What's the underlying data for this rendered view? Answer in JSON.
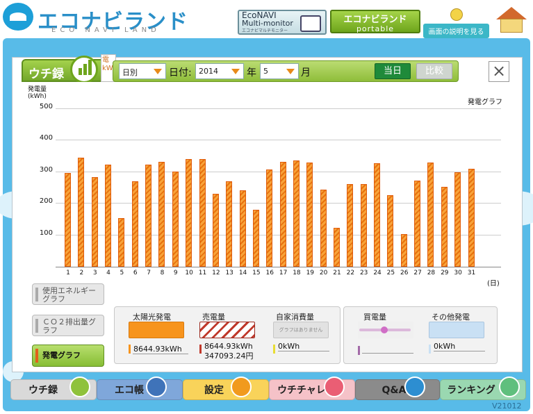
{
  "header": {
    "logo_text": "エコナビランド",
    "logo_sub": "ECO NAVI LAND",
    "econavi_line1": "EcoNAVI",
    "econavi_line2": "Multi-monitor",
    "econavi_line3": "エコナビマルチモニター",
    "portable_line1": "エコナビランド",
    "portable_line2": "portable",
    "help_label": "画面の説明を見る"
  },
  "panel": {
    "title": "ウチ録",
    "tab_kw": "電 kW",
    "period_select": "日別",
    "date_label": "日付:",
    "year_value": "2014",
    "year_label": "年",
    "month_value": "5",
    "month_label": "月",
    "today_button": "当日",
    "compare_button": "比較",
    "close_icon": "×"
  },
  "chart_data": {
    "type": "bar",
    "title": "発電グラフ",
    "ylabel": "発電量 (kWh)",
    "ylim": [
      0,
      500
    ],
    "yticks": [
      "100",
      "200",
      "300",
      "400",
      "500"
    ],
    "x_unit": "(日)",
    "categories": [
      "1",
      "2",
      "3",
      "4",
      "5",
      "6",
      "7",
      "8",
      "9",
      "10",
      "11",
      "12",
      "13",
      "14",
      "15",
      "16",
      "17",
      "18",
      "19",
      "20",
      "21",
      "22",
      "23",
      "24",
      "25",
      "26",
      "27",
      "28",
      "29",
      "30",
      "31"
    ],
    "values": [
      295,
      345,
      283,
      322,
      153,
      270,
      323,
      331,
      300,
      340,
      339,
      230,
      270,
      242,
      180,
      306,
      332,
      336,
      328,
      243,
      123,
      261,
      262,
      327,
      225,
      102,
      273,
      330,
      252,
      298,
      310
    ],
    "bar_color": "#f0901f"
  },
  "side_buttons": {
    "energy": "使用エネルギーグラフ",
    "co2": "ＣＯ２排出量グラフ",
    "gen": "発電グラフ"
  },
  "legend": {
    "solar_label": "太陽光発電",
    "solar_value": "8644.93kWh",
    "sold_label": "売電量",
    "sold_value": "8644.93kWh",
    "sold_yen": "347093.24円",
    "self_label": "自家消費量",
    "self_note": "グラフはありません",
    "self_value": "0kWh",
    "buy_label": "買電量",
    "other_label": "その他発電",
    "other_value": "0kWh"
  },
  "nav": {
    "uchiroku": "ウチ録",
    "ecocho": "エコ帳",
    "settings": "設定",
    "uchichare": "ウチチャレ",
    "qa": "Q&A",
    "ranking": "ランキング"
  },
  "version": "V21012"
}
